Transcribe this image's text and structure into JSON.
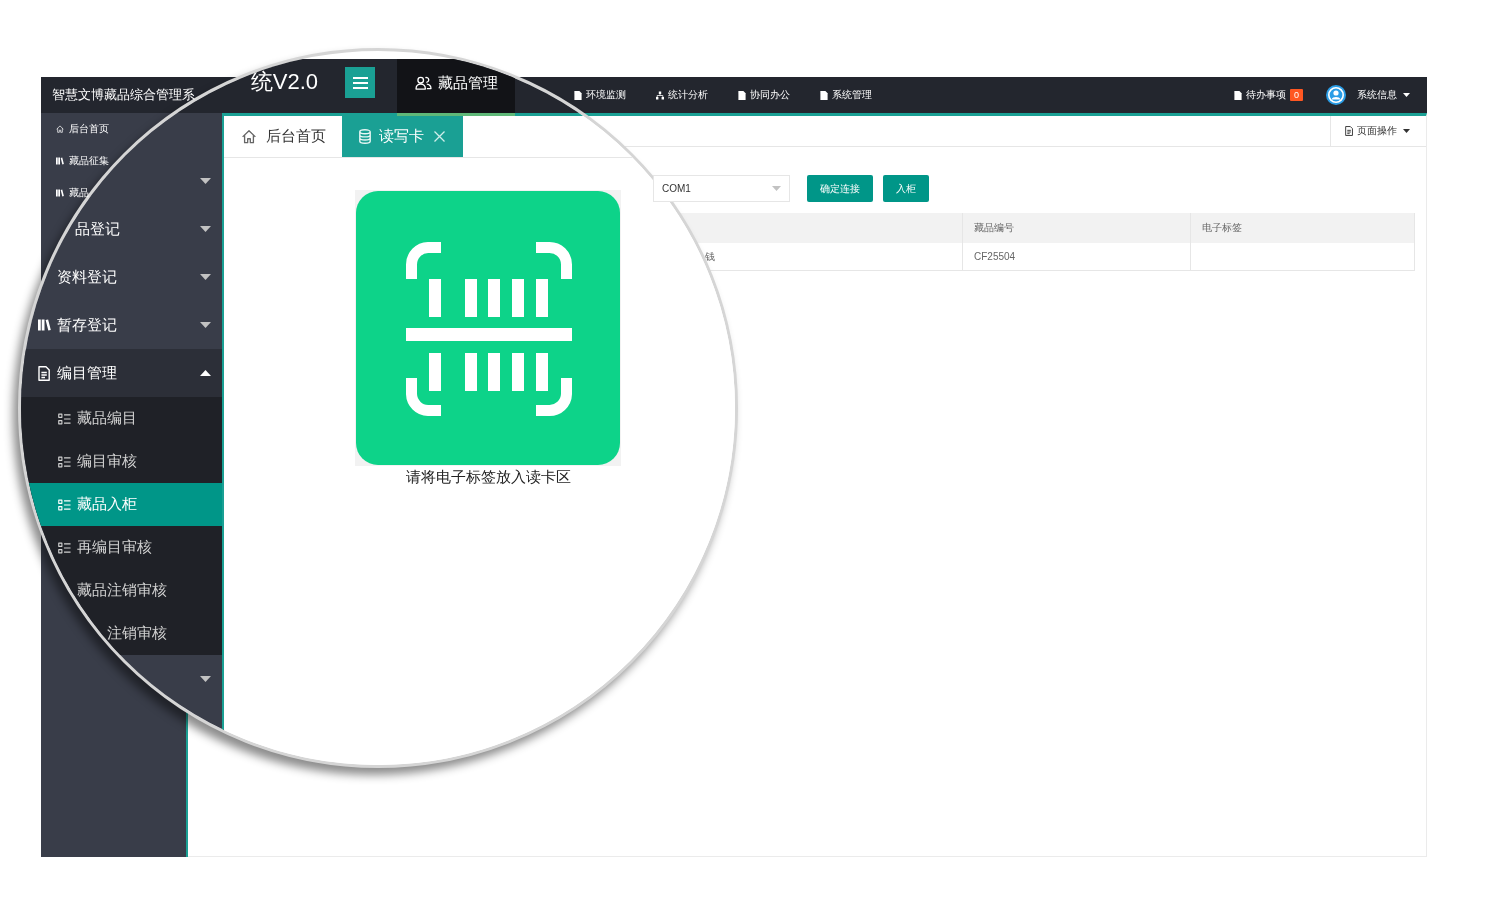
{
  "header": {
    "title": "智慧文博藏品综合管理系",
    "nav": [
      {
        "label": "环境监测"
      },
      {
        "label": "统计分析"
      },
      {
        "label": "协同办公"
      },
      {
        "label": "系统管理"
      }
    ],
    "todo": {
      "label": "待办事项",
      "count": "0"
    },
    "user": {
      "label": "系统信息"
    }
  },
  "sidebar": {
    "items": [
      {
        "label": "后台首页"
      },
      {
        "label": "藏品征集"
      },
      {
        "label": "藏品"
      }
    ]
  },
  "tab_bar": {
    "page_menu": "页面操作"
  },
  "reader_form": {
    "port": "COM1",
    "buttons": [
      "确定连接",
      "入柜"
    ]
  },
  "table": {
    "columns": [
      {},
      {
        "heading": "藏品编号"
      },
      {
        "heading": "电子标签"
      }
    ],
    "rows": [
      {
        "cells": [
          {
            "text": "钱"
          },
          {
            "text": "CF25504"
          },
          {}
        ]
      }
    ]
  },
  "magnifier": {
    "header": {
      "title": "统V2.0",
      "nav": [
        {
          "label": "藏品管理",
          "selected": true
        }
      ]
    },
    "sidebar": {
      "items": [
        {
          "expanded": false
        },
        {
          "label": "品登记",
          "expanded": false
        },
        {
          "label": "资料登记",
          "expanded": false
        },
        {
          "label": "暂存登记",
          "expanded": false
        },
        {
          "label": "编目管理",
          "expanded": true,
          "children": [
            {
              "label": "藏品编目",
              "selected": false
            },
            {
              "label": "编目审核",
              "selected": false
            },
            {
              "label": "藏品入柜",
              "selected": true
            },
            {
              "label": "再编目审核",
              "selected": false
            },
            {
              "label": "藏品注销审核",
              "selected": false
            },
            {
              "label": "注销审核",
              "selected": false
            }
          ]
        },
        {
          "expanded": false
        }
      ]
    },
    "tabs": [
      {
        "label": "后台首页",
        "selected": false,
        "closable": false
      },
      {
        "label": "读写卡",
        "selected": true,
        "closable": true
      }
    ],
    "prompt": "请将电子标签放入读卡区"
  }
}
